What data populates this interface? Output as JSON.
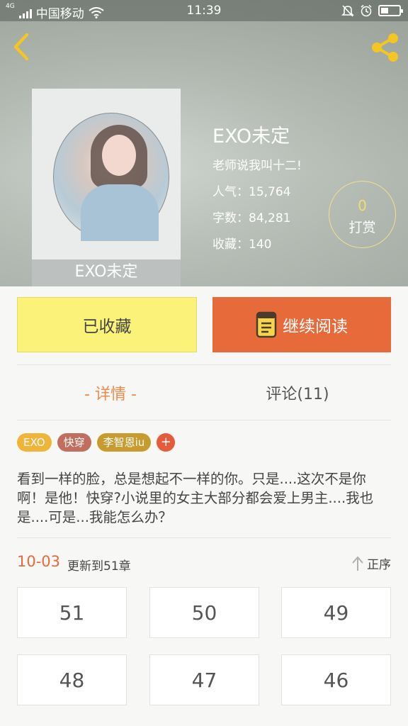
{
  "status_bar": {
    "network_type": "4G",
    "carrier": "中国移动",
    "time": "11:39"
  },
  "book": {
    "cover_title": "EXO未定",
    "title": "EXO未定",
    "author": "老师说我叫十二!",
    "popularity": "人气：15,764",
    "word_count": "字数：84,281",
    "favorites": "收藏：140"
  },
  "reward": {
    "count": "0",
    "label": "打赏"
  },
  "actions": {
    "collected_label": "已收藏",
    "continue_label": "继续阅读"
  },
  "tabs": {
    "detail": "- 详情 -",
    "comments": "评论(11)"
  },
  "tags": [
    {
      "label": "EXO",
      "color": "#f0b43a"
    },
    {
      "label": "快穿",
      "color": "#c06f5e"
    },
    {
      "label": "李智恩iu",
      "color": "#c99a2e"
    },
    {
      "label": "+",
      "color": "#e55c3c"
    }
  ],
  "description": "看到一样的脸，总是想起不一样的你。只是....这次不是你啊！是他！快穿?小说里的女主大部分都会爱上男主....我也是....可是...我能怎么办？",
  "update": {
    "date": "10-03",
    "text": "更新到51章",
    "sort_label": "正序"
  },
  "chapters": [
    "51",
    "50",
    "49",
    "48",
    "47",
    "46"
  ],
  "colors": {
    "accent_orange": "#e76a3a",
    "collected_yellow": "#fbf27a",
    "share_icon": "#f3c623",
    "back_icon": "#f3c623"
  }
}
